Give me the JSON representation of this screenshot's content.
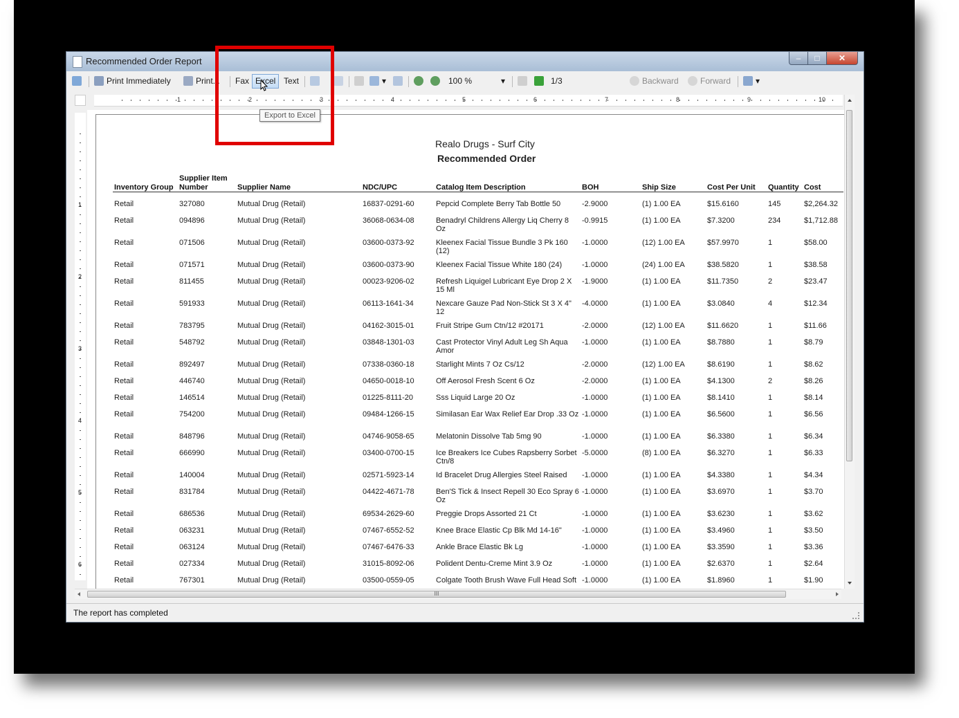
{
  "window": {
    "title": "Recommended Order Report"
  },
  "toolbar": {
    "print_immediately": "Print Immediately",
    "print": "Print...",
    "fax": "Fax",
    "excel": "Excel",
    "text": "Text",
    "zoom": "100 %",
    "page": "1/3",
    "backward": "Backward",
    "forward": "Forward"
  },
  "tooltip": "Export to Excel",
  "ruler": {
    "h": [
      "1",
      "2",
      "3",
      "4",
      "5",
      "6",
      "7",
      "8",
      "9",
      "10"
    ],
    "v": [
      "1",
      "2",
      "3",
      "4",
      "5",
      "6"
    ]
  },
  "report": {
    "company": "Realo Drugs - Surf City",
    "title": "Recommended Order",
    "headers": {
      "inventory_group": "Inventory Group",
      "supplier_item_1": "Supplier Item",
      "supplier_item_2": "Number",
      "supplier_name": "Supplier Name",
      "ndc": "NDC/UPC",
      "catalog": "Catalog Item Description",
      "boh": "BOH",
      "ship": "Ship Size",
      "cpu": "Cost Per Unit",
      "qty": "Quantity",
      "cost": "Cost"
    },
    "rows": [
      [
        "Retail",
        "327080",
        "Mutual Drug (Retail)",
        "16837-0291-60",
        "Pepcid Complete Berry Tab Bottle 50",
        "-2.9000",
        "(1) 1.00 EA",
        "$15.6160",
        "145",
        "$2,264.32"
      ],
      [
        "Retail",
        "094896",
        "Mutual Drug (Retail)",
        "36068-0634-08",
        "Benadryl Childrens Allergy Liq Cherry 8 Oz",
        "-0.9915",
        "(1) 1.00 EA",
        "$7.3200",
        "234",
        "$1,712.88"
      ],
      [
        "Retail",
        "071506",
        "Mutual Drug (Retail)",
        "03600-0373-92",
        "Kleenex Facial Tissue Bundle 3 Pk 160 (12)",
        "-1.0000",
        "(12) 1.00 EA",
        "$57.9970",
        "1",
        "$58.00"
      ],
      [
        "Retail",
        "071571",
        "Mutual Drug (Retail)",
        "03600-0373-90",
        "Kleenex Facial Tissue White 180 (24)",
        "-1.0000",
        "(24) 1.00 EA",
        "$38.5820",
        "1",
        "$38.58"
      ],
      [
        "Retail",
        "811455",
        "Mutual Drug (Retail)",
        "00023-9206-02",
        "Refresh Liquigel Lubricant Eye Drop 2 X 15 Ml",
        "-1.9000",
        "(1) 1.00 EA",
        "$11.7350",
        "2",
        "$23.47"
      ],
      [
        "Retail",
        "591933",
        "Mutual Drug (Retail)",
        "06113-1641-34",
        "Nexcare Gauze Pad Non-Stick St 3 X 4\" 12",
        "-4.0000",
        "(1) 1.00 EA",
        "$3.0840",
        "4",
        "$12.34"
      ],
      [
        "Retail",
        "783795",
        "Mutual Drug (Retail)",
        "04162-3015-01",
        "Fruit Stripe Gum Ctn/12 #20171",
        "-2.0000",
        "(12) 1.00 EA",
        "$11.6620",
        "1",
        "$11.66"
      ],
      [
        "Retail",
        "548792",
        "Mutual Drug (Retail)",
        "03848-1301-03",
        "Cast Protector Vinyl Adult Leg Sh Aqua Amor",
        "-1.0000",
        "(1) 1.00 EA",
        "$8.7880",
        "1",
        "$8.79"
      ],
      [
        "Retail",
        "892497",
        "Mutual Drug (Retail)",
        "07338-0360-18",
        "Starlight Mints 7 Oz Cs/12",
        "-2.0000",
        "(12) 1.00 EA",
        "$8.6190",
        "1",
        "$8.62"
      ],
      [
        "Retail",
        "446740",
        "Mutual Drug (Retail)",
        "04650-0018-10",
        "Off Aerosol Fresh Scent 6 Oz",
        "-2.0000",
        "(1) 1.00 EA",
        "$4.1300",
        "2",
        "$8.26"
      ],
      [
        "Retail",
        "146514",
        "Mutual Drug (Retail)",
        "01225-8111-20",
        "Sss Liquid Large 20 Oz",
        "-1.0000",
        "(1) 1.00 EA",
        "$8.1410",
        "1",
        "$8.14"
      ],
      [
        "Retail",
        "754200",
        "Mutual Drug (Retail)",
        "09484-1266-15",
        "Similasan Ear Wax Relief Ear Drop .33 Oz",
        "-1.0000",
        "(1) 1.00 EA",
        "$6.5600",
        "1",
        "$6.56"
      ],
      [
        "Retail",
        "848796",
        "Mutual Drug (Retail)",
        "04746-9058-65",
        "Melatonin Dissolve Tab 5mg 90",
        "-1.0000",
        "(1) 1.00 EA",
        "$6.3380",
        "1",
        "$6.34"
      ],
      [
        "Retail",
        "666990",
        "Mutual Drug (Retail)",
        "03400-0700-15",
        "Ice Breakers Ice Cubes Rapsberry Sorbet Ctn/8",
        "-5.0000",
        "(8) 1.00 EA",
        "$6.3270",
        "1",
        "$6.33"
      ],
      [
        "Retail",
        "140004",
        "Mutual Drug (Retail)",
        "02571-5923-14",
        "Id Bracelet Drug Allergies Steel Raised",
        "-1.0000",
        "(1) 1.00 EA",
        "$4.3380",
        "1",
        "$4.34"
      ],
      [
        "Retail",
        "831784",
        "Mutual Drug (Retail)",
        "04422-4671-78",
        "Ben'S Tick & Insect Repell 30 Eco Spray 6 Oz",
        "-1.0000",
        "(1) 1.00 EA",
        "$3.6970",
        "1",
        "$3.70"
      ],
      [
        "Retail",
        "686536",
        "Mutual Drug (Retail)",
        "69534-2629-60",
        "Preggie Drops Assorted 21 Ct",
        "-1.0000",
        "(1) 1.00 EA",
        "$3.6230",
        "1",
        "$3.62"
      ],
      [
        "Retail",
        "063231",
        "Mutual Drug (Retail)",
        "07467-6552-52",
        "Knee Brace Elastic Cp Blk Md 14-16\"",
        "-1.0000",
        "(1) 1.00 EA",
        "$3.4960",
        "1",
        "$3.50"
      ],
      [
        "Retail",
        "063124",
        "Mutual Drug (Retail)",
        "07467-6476-33",
        "Ankle Brace Elastic Bk Lg",
        "-1.0000",
        "(1) 1.00 EA",
        "$3.3590",
        "1",
        "$3.36"
      ],
      [
        "Retail",
        "027334",
        "Mutual Drug (Retail)",
        "31015-8092-06",
        "Polident Dentu-Creme Mint 3.9 Oz",
        "-1.0000",
        "(1) 1.00 EA",
        "$2.6370",
        "1",
        "$2.64"
      ],
      [
        "Retail",
        "767301",
        "Mutual Drug (Retail)",
        "03500-0559-05",
        "Colgate Tooth Brush Wave Full Head Soft",
        "-1.0000",
        "(1) 1.00 EA",
        "$1.8960",
        "1",
        "$1.90"
      ]
    ]
  },
  "scrollbar": {
    "grip": "III"
  },
  "status": {
    "text": "The report has completed"
  },
  "colors": {
    "highlight": "#e00000",
    "excel_button_bg": "#c4dcf5"
  }
}
